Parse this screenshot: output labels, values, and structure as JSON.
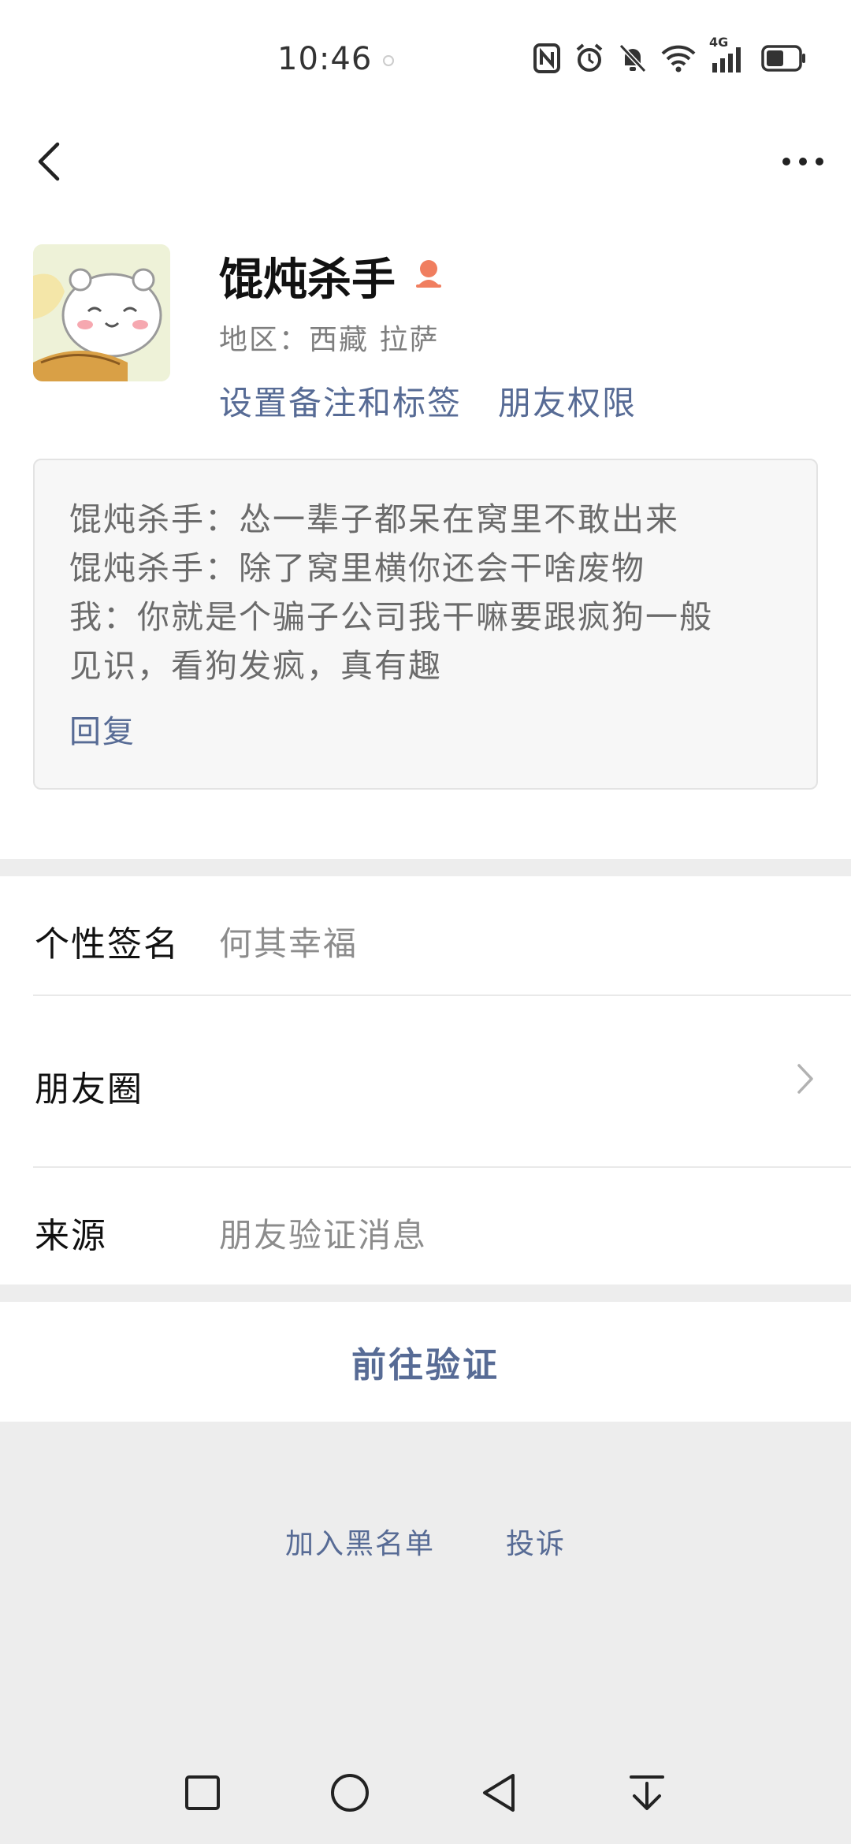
{
  "status_bar": {
    "time": "10:46",
    "network_label": "4G",
    "icons": [
      "nfc-icon",
      "alarm-icon",
      "bell-muted-icon",
      "wifi-icon",
      "signal-icon",
      "battery-icon"
    ],
    "battery_level": 0.55
  },
  "nav": {
    "back_icon": "chevron-left-icon",
    "more_icon": "more-dots-icon"
  },
  "profile": {
    "name": "馄炖杀手",
    "gender_icon": "female-icon",
    "region": "地区：西藏 拉萨",
    "links": {
      "set_remark": "设置备注和标签",
      "friend_permissions": "朋友权限"
    }
  },
  "message_card": {
    "lines": [
      "馄炖杀手：怂一辈子都呆在窝里不敢出来",
      "馄炖杀手：除了窝里横你还会干啥废物",
      "我：你就是个骗子公司我干嘛要跟疯狗一般",
      "见识，看狗发疯，真有趣"
    ],
    "reply": "回复"
  },
  "info": {
    "signature_label": "个性签名",
    "signature_value": "何其幸福",
    "moments_label": "朋友圈",
    "source_label": "来源",
    "source_value": "朋友验证消息"
  },
  "actions": {
    "verify": "前往验证"
  },
  "footer": {
    "blacklist": "加入黑名单",
    "report": "投诉"
  },
  "colors": {
    "link_blue": "#576b95",
    "background": "#ededed",
    "gender_orange": "#f07e5f"
  }
}
